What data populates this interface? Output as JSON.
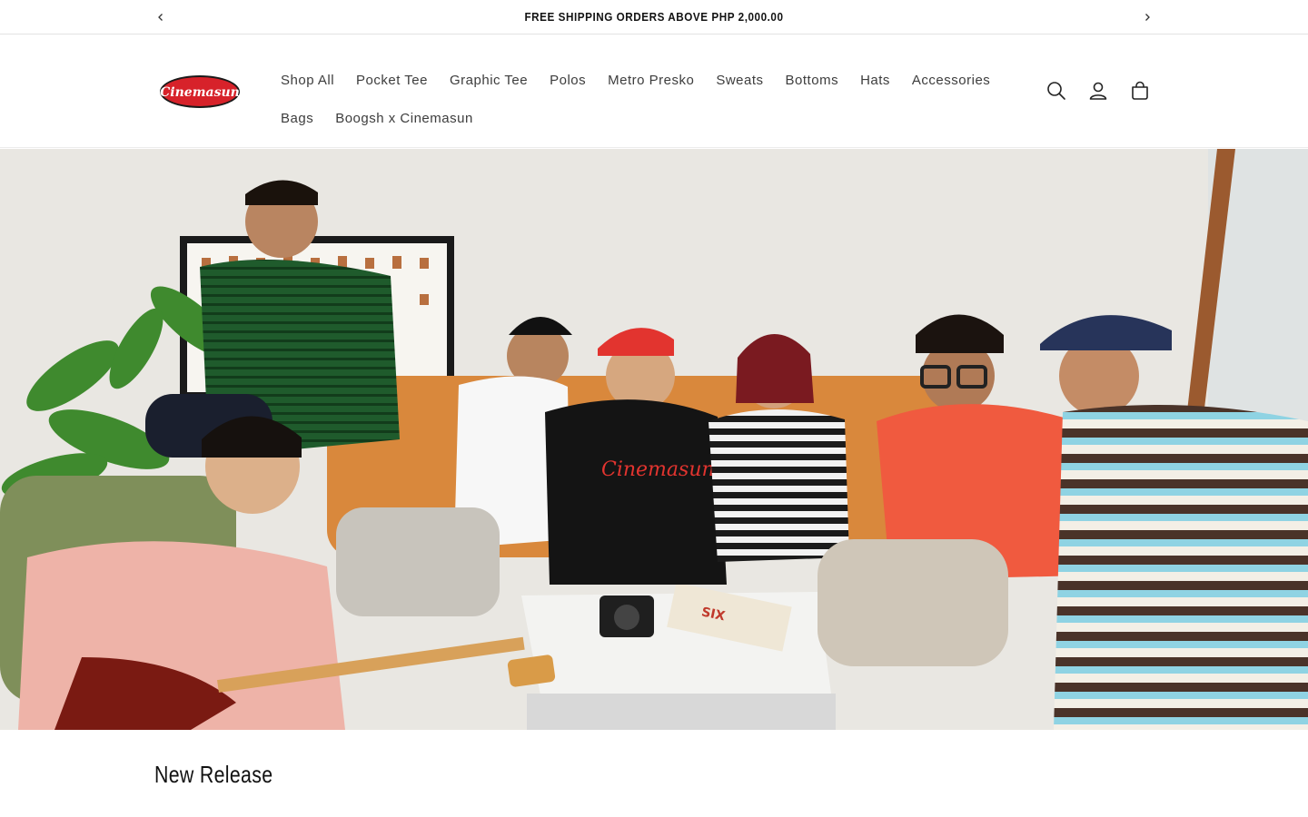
{
  "announcement": {
    "text": "FREE SHIPPING ORDERS ABOVE PHP 2,000.00",
    "prev_icon": "chevron-left-icon",
    "next_icon": "chevron-right-icon"
  },
  "header": {
    "logo_text": "Cinemasun",
    "logo_color": "#d7222a",
    "nav_row1": [
      "Shop All",
      "Pocket Tee",
      "Graphic Tee",
      "Polos",
      "Metro Presko",
      "Sweats",
      "Bottoms",
      "Hats",
      "Accessories"
    ],
    "nav_row2": [
      "Bags",
      "Boogsh x Cinemasun"
    ],
    "icons": [
      "search-icon",
      "account-icon",
      "cart-icon"
    ]
  },
  "hero": {
    "image": "group-photo-banner"
  },
  "sections": {
    "new_release_title": "New Release"
  }
}
